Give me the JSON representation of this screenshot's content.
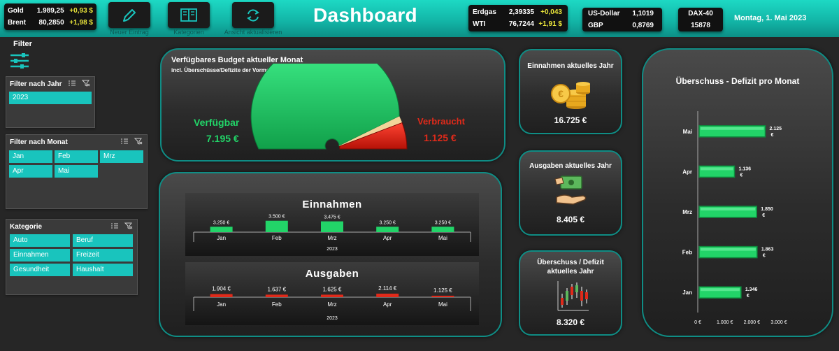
{
  "commodities": [
    {
      "name": "Gold",
      "value": "1.989,25",
      "change": "+0,93 $"
    },
    {
      "name": "Brent",
      "value": "80,2850",
      "change": "+1,98 $"
    }
  ],
  "energy": [
    {
      "name": "Erdgas",
      "value": "2,39335",
      "change": "+0,043"
    },
    {
      "name": "WTI",
      "value": "76,7244",
      "change": "+1,91 $"
    }
  ],
  "currencies": [
    {
      "name": "US-Dollar",
      "value": "1,1019"
    },
    {
      "name": "GBP",
      "value": "0,8769"
    }
  ],
  "index": {
    "name": "DAX-40",
    "value": "15878"
  },
  "toolbar": {
    "new_entry": "Neuer Eintrag",
    "categories": "Kategorien",
    "refresh": "Ansicht aktualisieren"
  },
  "header": {
    "title": "Dashboard",
    "date": "Montag, 1. Mai 2023"
  },
  "filter": {
    "heading": "Filter",
    "year": {
      "title": "Filter nach Jahr",
      "items": [
        "2023"
      ]
    },
    "month": {
      "title": "Filter nach Monat",
      "items": [
        "Jan",
        "Feb",
        "Mrz",
        "Apr",
        "Mai"
      ]
    },
    "category": {
      "title": "Kategorie",
      "items": [
        "Auto",
        "Beruf",
        "Einnahmen",
        "Freizeit",
        "Gesundheit",
        "Haushalt"
      ]
    }
  },
  "budget": {
    "title": "Verfügbares Budget aktueller Monat",
    "subtitle": "incl. Überschüsse/Defizite der Vormonate",
    "available_label": "Verfügbar",
    "available_value": "7.195 €",
    "used_label": "Verbraucht",
    "used_value": "1.125 €",
    "available": 7195,
    "used": 1125
  },
  "kpis": {
    "income": {
      "title": "Einnahmen aktuelles Jahr",
      "value": "16.725 €"
    },
    "expenses": {
      "title": "Ausgaben aktuelles Jahr",
      "value": "8.405 €"
    },
    "surplus": {
      "title_line1": "Überschuss / Defizit",
      "title_line2": "aktuelles Jahr",
      "value": "8.320 €"
    }
  },
  "colors": {
    "accent": "#19c4bd",
    "positive": "#22d468",
    "negative": "#e02a1a",
    "gain": "#e8e33a"
  },
  "chart_data": [
    {
      "type": "bar",
      "title": "Einnahmen",
      "categories": [
        "Jan",
        "Feb",
        "Mrz",
        "Apr",
        "Mai"
      ],
      "values": [
        3250,
        3500,
        3475,
        3250,
        3250
      ],
      "labels": [
        "3.250 €",
        "3.500 €",
        "3.475 €",
        "3.250 €",
        "3.250 €"
      ],
      "xlabel": "2023",
      "color": "#22d468"
    },
    {
      "type": "bar",
      "title": "Ausgaben",
      "categories": [
        "Jan",
        "Feb",
        "Mrz",
        "Apr",
        "Mai"
      ],
      "values": [
        1904,
        1637,
        1625,
        2114,
        1125
      ],
      "labels": [
        "1.904 €",
        "1.637 €",
        "1.625 €",
        "2.114 €",
        "1.125 €"
      ],
      "xlabel": "2023",
      "color": "#e02a1a"
    },
    {
      "type": "bar",
      "orientation": "horizontal",
      "title": "Überschuss - Defizit pro Monat",
      "categories": [
        "Mai",
        "Apr",
        "Mrz",
        "Feb",
        "Jan"
      ],
      "values": [
        2125,
        1136,
        1850,
        1863,
        1346
      ],
      "labels": [
        "2.125 €",
        "1.136 €",
        "1.850 €",
        "1.863 €",
        "1.346 €"
      ],
      "xticks": [
        "0 €",
        "1.000 €",
        "2.000 €",
        "3.000 €"
      ],
      "xlim": [
        0,
        3000
      ],
      "color": "#22d468"
    }
  ]
}
